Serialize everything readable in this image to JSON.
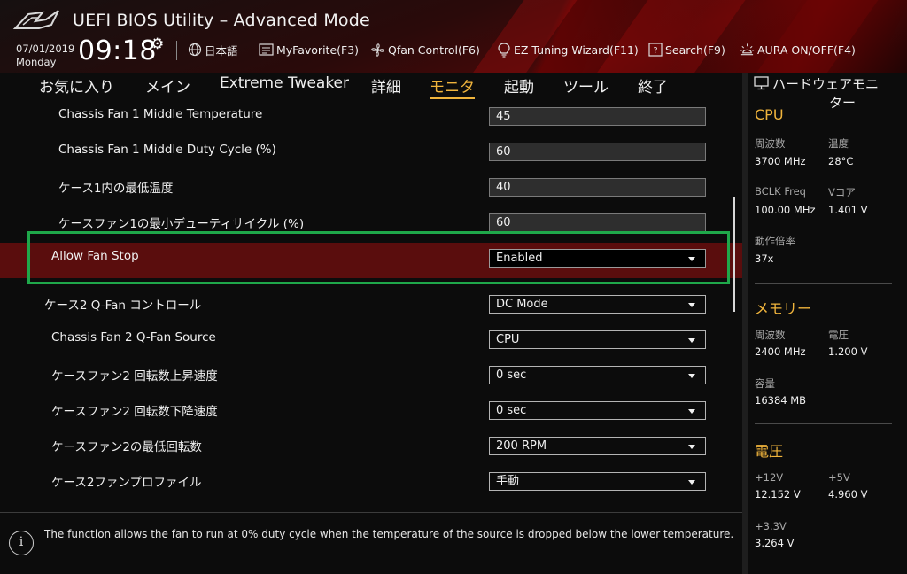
{
  "header": {
    "title": "UEFI BIOS Utility – Advanced Mode",
    "date": "07/01/2019",
    "day": "Monday",
    "time": "09:18",
    "items": [
      {
        "icon": "globe-icon",
        "label": "日本語"
      },
      {
        "icon": "favorites-icon",
        "label": "MyFavorite(F3)"
      },
      {
        "icon": "fan-icon",
        "label": "Qfan Control(F6)"
      },
      {
        "icon": "bulb-icon",
        "label": "EZ Tuning Wizard(F11)"
      },
      {
        "icon": "search-icon",
        "label": "Search(F9)"
      },
      {
        "icon": "aura-icon",
        "label": "AURA ON/OFF(F4)"
      }
    ]
  },
  "nav": {
    "tabs": [
      "お気に入り",
      "メイン",
      "Extreme Tweaker",
      "詳細",
      "モニタ",
      "起動",
      "ツール",
      "終了"
    ],
    "active_index": 4
  },
  "settings": [
    {
      "label": "Chassis Fan 1 Middle Temperature",
      "type": "text",
      "value": "45"
    },
    {
      "label": "Chassis Fan 1 Middle Duty Cycle (%)",
      "type": "text",
      "value": "60"
    },
    {
      "label": "ケース1内の最低温度",
      "type": "text",
      "value": "40"
    },
    {
      "label": "ケースファン1の最小デューティサイクル (%)",
      "type": "text",
      "value": "60"
    },
    {
      "label": "Allow Fan Stop",
      "type": "select",
      "value": "Enabled",
      "selected": true
    },
    {
      "label": "ケース2 Q-Fan コントロール",
      "type": "select",
      "value": "DC Mode"
    },
    {
      "label": "Chassis Fan 2 Q-Fan Source",
      "type": "select",
      "value": "CPU"
    },
    {
      "label": "ケースファン2 回転数上昇速度",
      "type": "select",
      "value": "0 sec"
    },
    {
      "label": "ケースファン2 回転数下降速度",
      "type": "select",
      "value": "0 sec"
    },
    {
      "label": "ケースファン2の最低回転数",
      "type": "select",
      "value": "200 RPM"
    },
    {
      "label": "ケース2ファンプロファイル",
      "type": "select",
      "value": "手動"
    }
  ],
  "help": {
    "text": "The function allows the fan to run at 0% duty cycle when the temperature of the source is dropped below the lower temperature."
  },
  "monitor": {
    "title_line1": "ハードウェアモニ",
    "title_line2": "ター",
    "cpu": {
      "heading": "CPU",
      "freq_label": "周波数",
      "freq": "3700 MHz",
      "temp_label": "温度",
      "temp": "28°C",
      "bclk_label": "BCLK Freq",
      "bclk": "100.00 MHz",
      "vcore_label": "Vコア",
      "vcore": "1.401 V",
      "ratio_label": "動作倍率",
      "ratio": "37x"
    },
    "memory": {
      "heading": "メモリー",
      "freq_label": "周波数",
      "freq": "2400 MHz",
      "volt_label": "電圧",
      "volt": "1.200 V",
      "cap_label": "容量",
      "cap": "16384 MB"
    },
    "voltage": {
      "heading": "電圧",
      "v12_label": "+12V",
      "v12": "12.152 V",
      "v5_label": "+5V",
      "v5": "4.960 V",
      "v33_label": "+3.3V",
      "v33": "3.264 V"
    }
  },
  "colors": {
    "accent": "#f0b43c",
    "selected_row": "#5a0d0d",
    "highlight_box": "#1fa84a"
  }
}
